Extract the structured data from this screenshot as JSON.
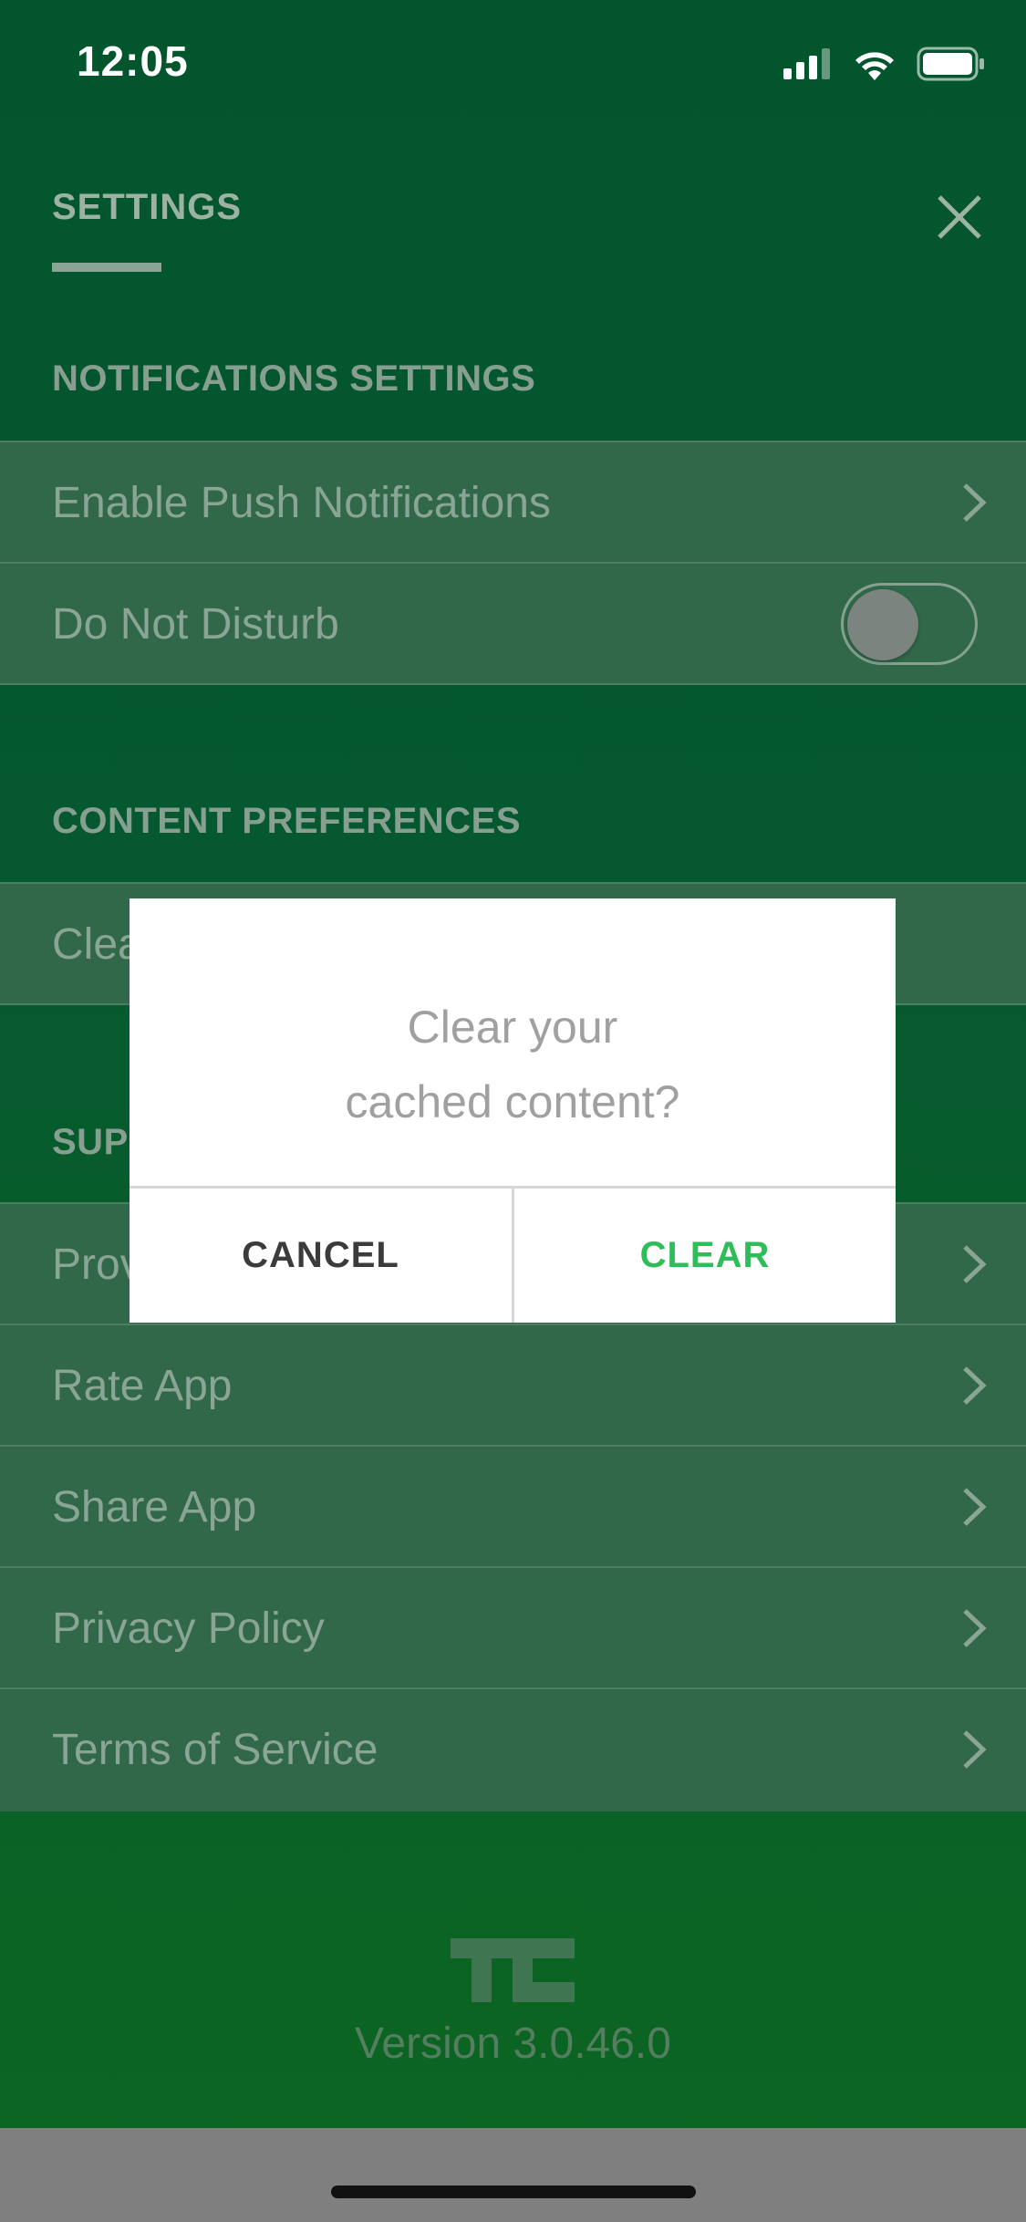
{
  "status_bar": {
    "time": "12:05"
  },
  "header": {
    "title": "SETTINGS"
  },
  "notifications": {
    "title": "NOTIFICATIONS SETTINGS",
    "enable_push": "Enable Push Notifications",
    "do_not_disturb": "Do Not Disturb",
    "do_not_disturb_on": false
  },
  "content": {
    "title": "CONTENT PREFERENCES",
    "clear_cache_partial": "Clea"
  },
  "support": {
    "title_partial": "SUP",
    "items": [
      {
        "label": "Prov",
        "icon": "chevron-right-icon"
      },
      {
        "label": "Rate App",
        "icon": "chevron-right-icon"
      },
      {
        "label": "Share App",
        "icon": "chevron-right-icon"
      },
      {
        "label": "Privacy Policy",
        "icon": "chevron-right-icon"
      },
      {
        "label": "Terms of Service",
        "icon": "chevron-right-icon"
      }
    ]
  },
  "footer": {
    "logo": "techcrunch-logo",
    "version": "Version 3.0.46.0"
  },
  "dialog": {
    "message_line1": "Clear your",
    "message_line2": "cached content?",
    "cancel_label": "CANCEL",
    "clear_label": "CLEAR"
  },
  "colors": {
    "accent": "#2fbd5a",
    "background": "#05582f",
    "row": "#306849"
  }
}
